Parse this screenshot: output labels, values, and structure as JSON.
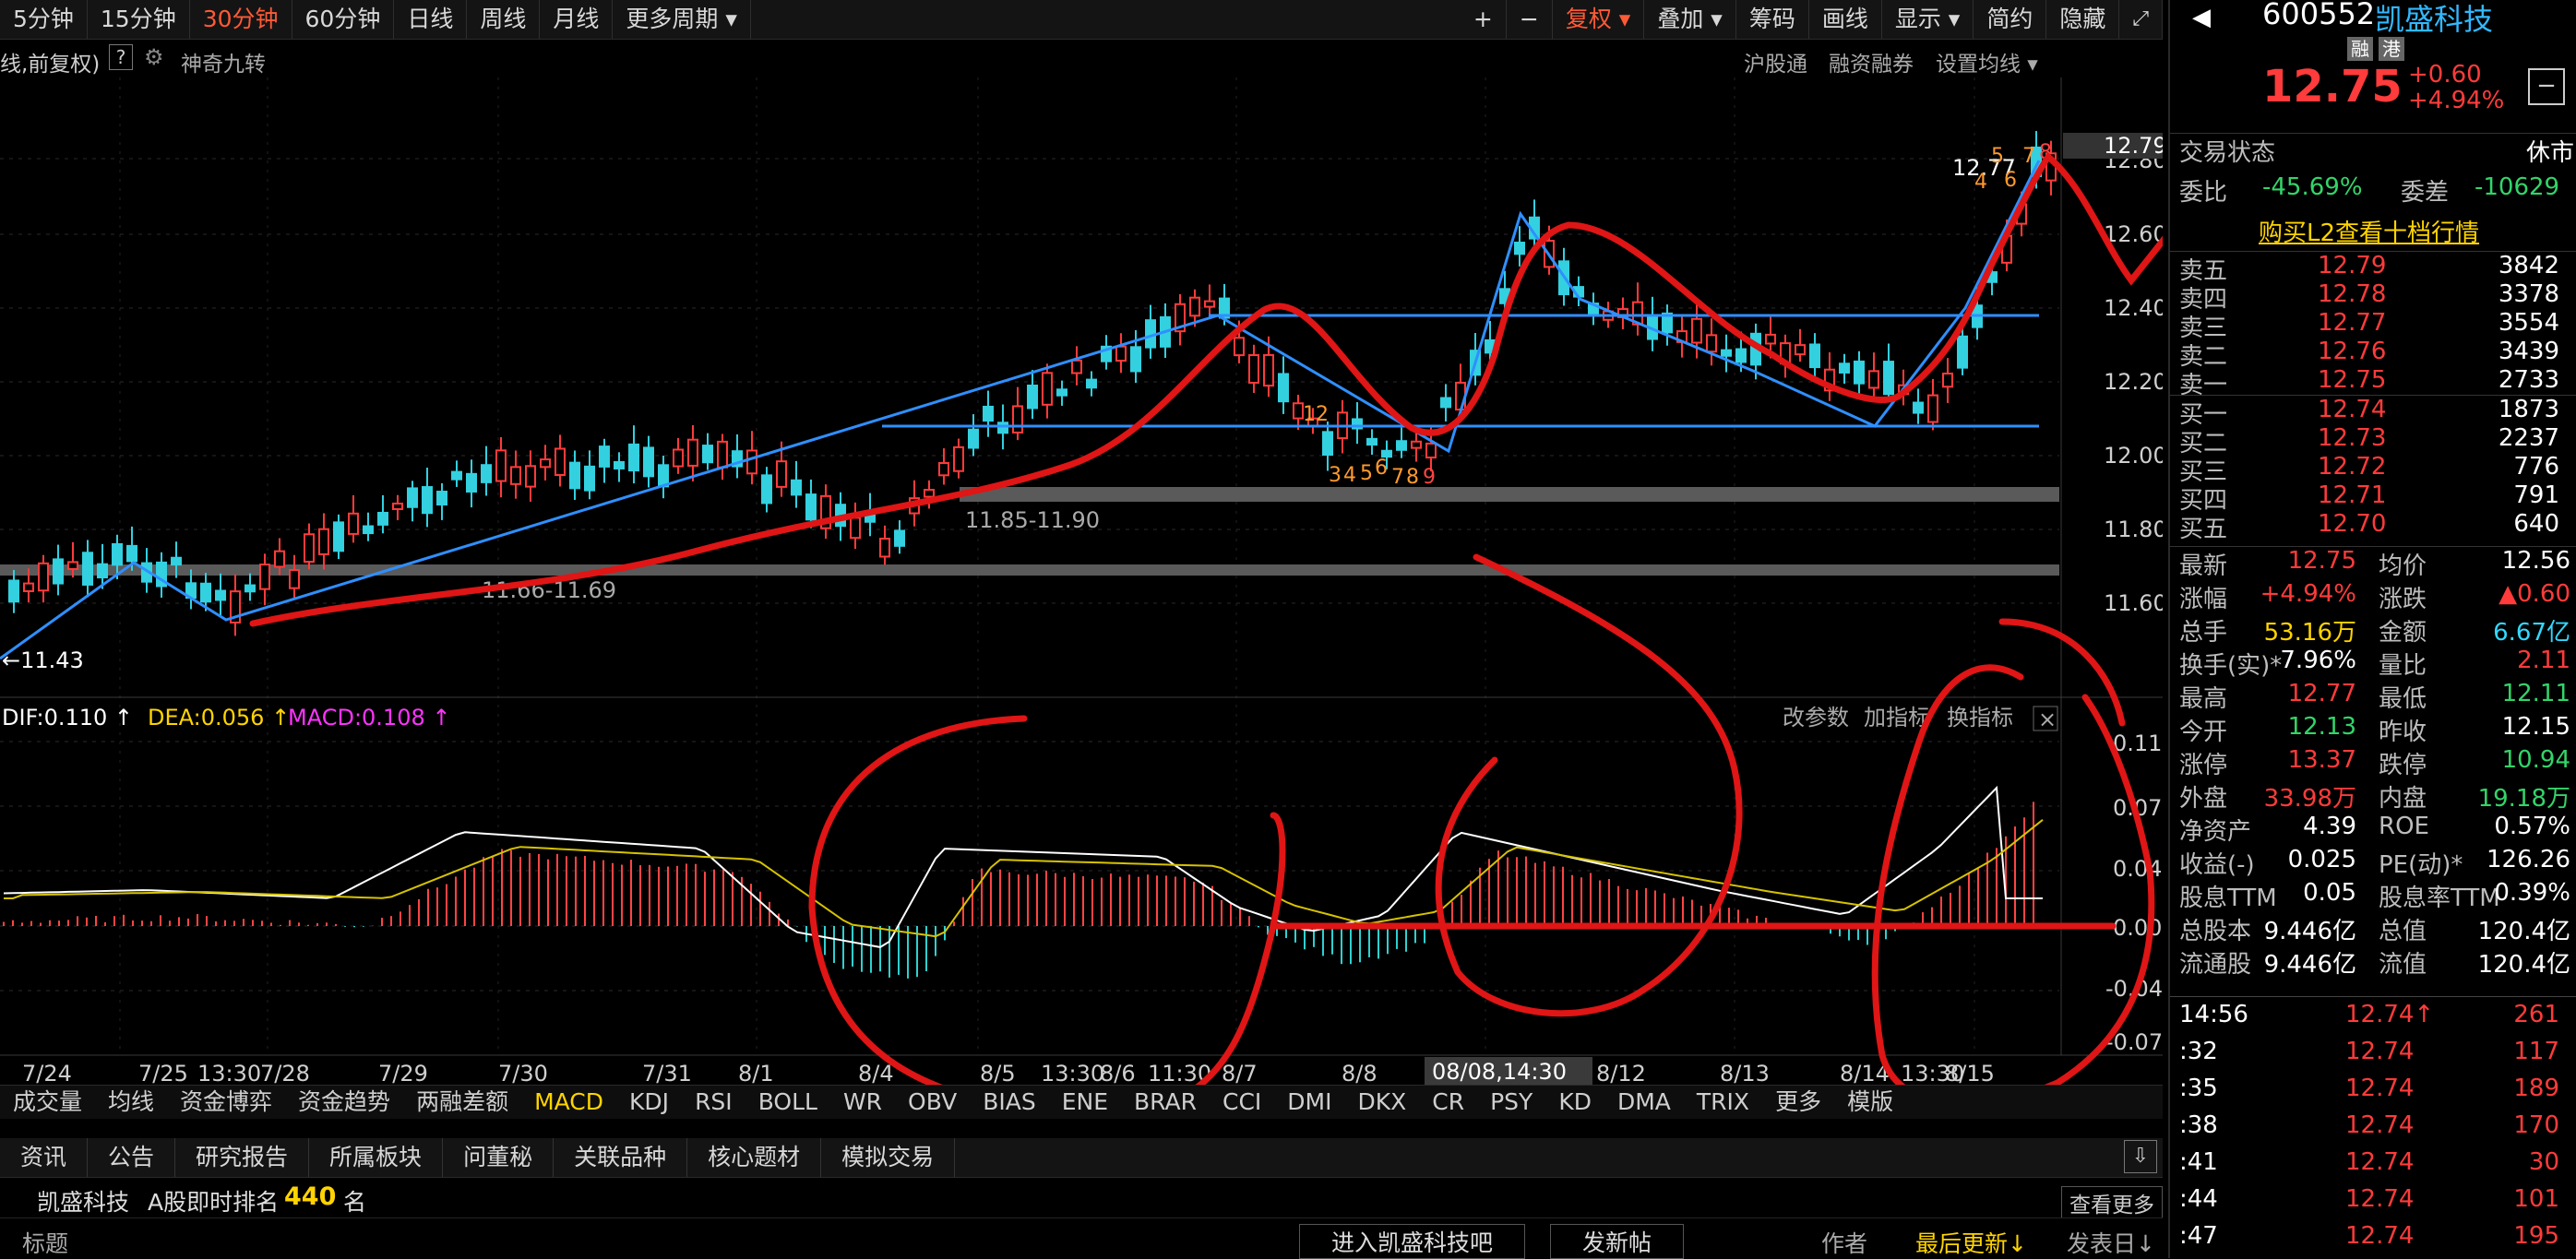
{
  "toolbar": {
    "periods": [
      "5分钟",
      "15分钟",
      "30分钟",
      "60分钟",
      "日线",
      "周线",
      "月线",
      "更多周期 ▾"
    ],
    "active_index": 2,
    "right": [
      "复权 ▾",
      "叠加 ▾",
      "筹码",
      "画线",
      "显示 ▾",
      "简约",
      "隐藏"
    ],
    "plus": "+",
    "minus": "−"
  },
  "sub_header": {
    "left": "线,前复权)",
    "help": "?",
    "tool": "神奇九转",
    "right": [
      "沪股通",
      "融资融券",
      "设置均线 ▾"
    ]
  },
  "price_axis": {
    "ticks": [
      "12.80",
      "12.60",
      "12.40",
      "12.20",
      "12.00",
      "11.80",
      "11.60"
    ],
    "last": "12.79"
  },
  "price_labels": {
    "low": "←11.43",
    "support1": "11.66-11.69",
    "support2": "11.85-11.90",
    "high": "12.77",
    "nine_a": [
      "3",
      "4",
      "5",
      "6",
      "7",
      "8",
      "9"
    ],
    "twelve": "12",
    "nine_b": [
      "4",
      "5",
      "6",
      "7",
      "8"
    ]
  },
  "macd": {
    "label": "DIF:0.110 ↑",
    "dea": "DEA:0.056 ↑",
    "macd": "MACD:0.108 ↑",
    "right": [
      "改参数",
      "加指标",
      "换指标"
    ],
    "close": "×",
    "axis": [
      "0.11",
      "0.07",
      "0.04",
      "0.00",
      "-0.04",
      "-0.07"
    ]
  },
  "date_axis": [
    "7/24",
    "7/25",
    "13:30",
    "7/28",
    "7/29",
    "7/30",
    "7/31",
    "8/1",
    "8/4",
    "8/5",
    "13:30",
    "8/6",
    "11:30",
    "8/7",
    "8/8",
    "8/12",
    "8/13",
    "8/14",
    "13:30",
    "8/15"
  ],
  "crosshair_date": "08/08,14:30",
  "indicators": [
    "成交量",
    "均线",
    "资金博弈",
    "资金趋势",
    "两融差额",
    "MACD",
    "KDJ",
    "RSI",
    "BOLL",
    "WR",
    "OBV",
    "BIAS",
    "ENE",
    "BRAR",
    "CCI",
    "DMI",
    "DKX",
    "CR",
    "PSY",
    "KD",
    "DMA",
    "TRIX",
    "更多",
    "模版"
  ],
  "indicator_sel": 5,
  "info_tabs": [
    "资讯",
    "公告",
    "研究报告",
    "所属板块",
    "问董秘",
    "关联品种",
    "核心题材",
    "模拟交易"
  ],
  "rank": {
    "name": "凯盛科技",
    "label": "A股即时排名",
    "value": "440",
    "unit": "名"
  },
  "list_header": {
    "title": "标题",
    "btn1": "进入凯盛科技吧",
    "btn2": "发新帖",
    "author": "作者",
    "updated": "最后更新↓",
    "posted": "发表日↓",
    "more": "查看更多"
  },
  "stock": {
    "code": "600552",
    "name": "凯盛科技",
    "tag1": "融",
    "tag2": "港",
    "price": "12.75",
    "change": "+0.60",
    "pct": "+4.94%"
  },
  "status": {
    "label": "交易状态",
    "value": "休市"
  },
  "ratio": {
    "label": "委比",
    "value": "-45.69%",
    "diff_label": "委差",
    "diff": "-10629"
  },
  "l2": "购买L2查看十档行情",
  "asks": [
    {
      "label": "卖五",
      "price": "12.79",
      "vol": "3842"
    },
    {
      "label": "卖四",
      "price": "12.78",
      "vol": "3378"
    },
    {
      "label": "卖三",
      "price": "12.77",
      "vol": "3554"
    },
    {
      "label": "卖二",
      "price": "12.76",
      "vol": "3439"
    },
    {
      "label": "卖一",
      "price": "12.75",
      "vol": "2733"
    }
  ],
  "bids": [
    {
      "label": "买一",
      "price": "12.74",
      "vol": "1873"
    },
    {
      "label": "买二",
      "price": "12.73",
      "vol": "2237"
    },
    {
      "label": "买三",
      "price": "12.72",
      "vol": "776"
    },
    {
      "label": "买四",
      "price": "12.71",
      "vol": "791"
    },
    {
      "label": "买五",
      "price": "12.70",
      "vol": "640"
    }
  ],
  "stats": [
    {
      "l1": "最新",
      "v1": "12.75",
      "c1": "red",
      "l2": "均价",
      "v2": "12.56",
      "c2": "white"
    },
    {
      "l1": "涨幅",
      "v1": "+4.94%",
      "c1": "red",
      "l2": "涨跌",
      "v2": "▲0.60",
      "c2": "red"
    },
    {
      "l1": "总手",
      "v1": "53.16万",
      "c1": "yellow",
      "l2": "金额",
      "v2": "6.67亿",
      "c2": "cyan"
    },
    {
      "l1": "换手(实)*",
      "v1": "7.96%",
      "c1": "white",
      "l2": "量比",
      "v2": "2.11",
      "c2": "red"
    },
    {
      "l1": "最高",
      "v1": "12.77",
      "c1": "red",
      "l2": "最低",
      "v2": "12.11",
      "c2": "green"
    },
    {
      "l1": "今开",
      "v1": "12.13",
      "c1": "green",
      "l2": "昨收",
      "v2": "12.15",
      "c2": "white"
    },
    {
      "l1": "涨停",
      "v1": "13.37",
      "c1": "red",
      "l2": "跌停",
      "v2": "10.94",
      "c2": "green"
    },
    {
      "l1": "外盘",
      "v1": "33.98万",
      "c1": "red",
      "l2": "内盘",
      "v2": "19.18万",
      "c2": "green"
    },
    {
      "l1": "净资产",
      "v1": "4.39",
      "c1": "white",
      "l2": "ROE",
      "v2": "0.57%",
      "c2": "white"
    },
    {
      "l1": "收益(-)",
      "v1": "0.025",
      "c1": "white",
      "l2": "PE(动)*",
      "v2": "126.26",
      "c2": "white"
    },
    {
      "l1": "股息TTM",
      "v1": "0.05",
      "c1": "white",
      "l2": "股息率TTM",
      "v2": "0.39%",
      "c2": "white"
    },
    {
      "l1": "总股本",
      "v1": "9.446亿",
      "c1": "white",
      "l2": "总值",
      "v2": "120.4亿",
      "c2": "white"
    },
    {
      "l1": "流通股",
      "v1": "9.446亿",
      "c1": "white",
      "l2": "流值",
      "v2": "120.4亿",
      "c2": "white"
    }
  ],
  "ticks": [
    {
      "t": "14:56",
      "p": "12.74↑",
      "v": "261"
    },
    {
      "t": ":32",
      "p": "12.74",
      "v": "117"
    },
    {
      "t": ":35",
      "p": "12.74",
      "v": "189"
    },
    {
      "t": ":38",
      "p": "12.74",
      "v": "170"
    },
    {
      "t": ":41",
      "p": "12.74",
      "v": "30"
    },
    {
      "t": ":44",
      "p": "12.74",
      "v": "101"
    },
    {
      "t": ":47",
      "p": "12.74",
      "v": "195"
    }
  ],
  "colors": {
    "up": "#ff3b3b",
    "down": "#33d0e0",
    "trend": "#2f8fff",
    "annot": "#e01515"
  }
}
